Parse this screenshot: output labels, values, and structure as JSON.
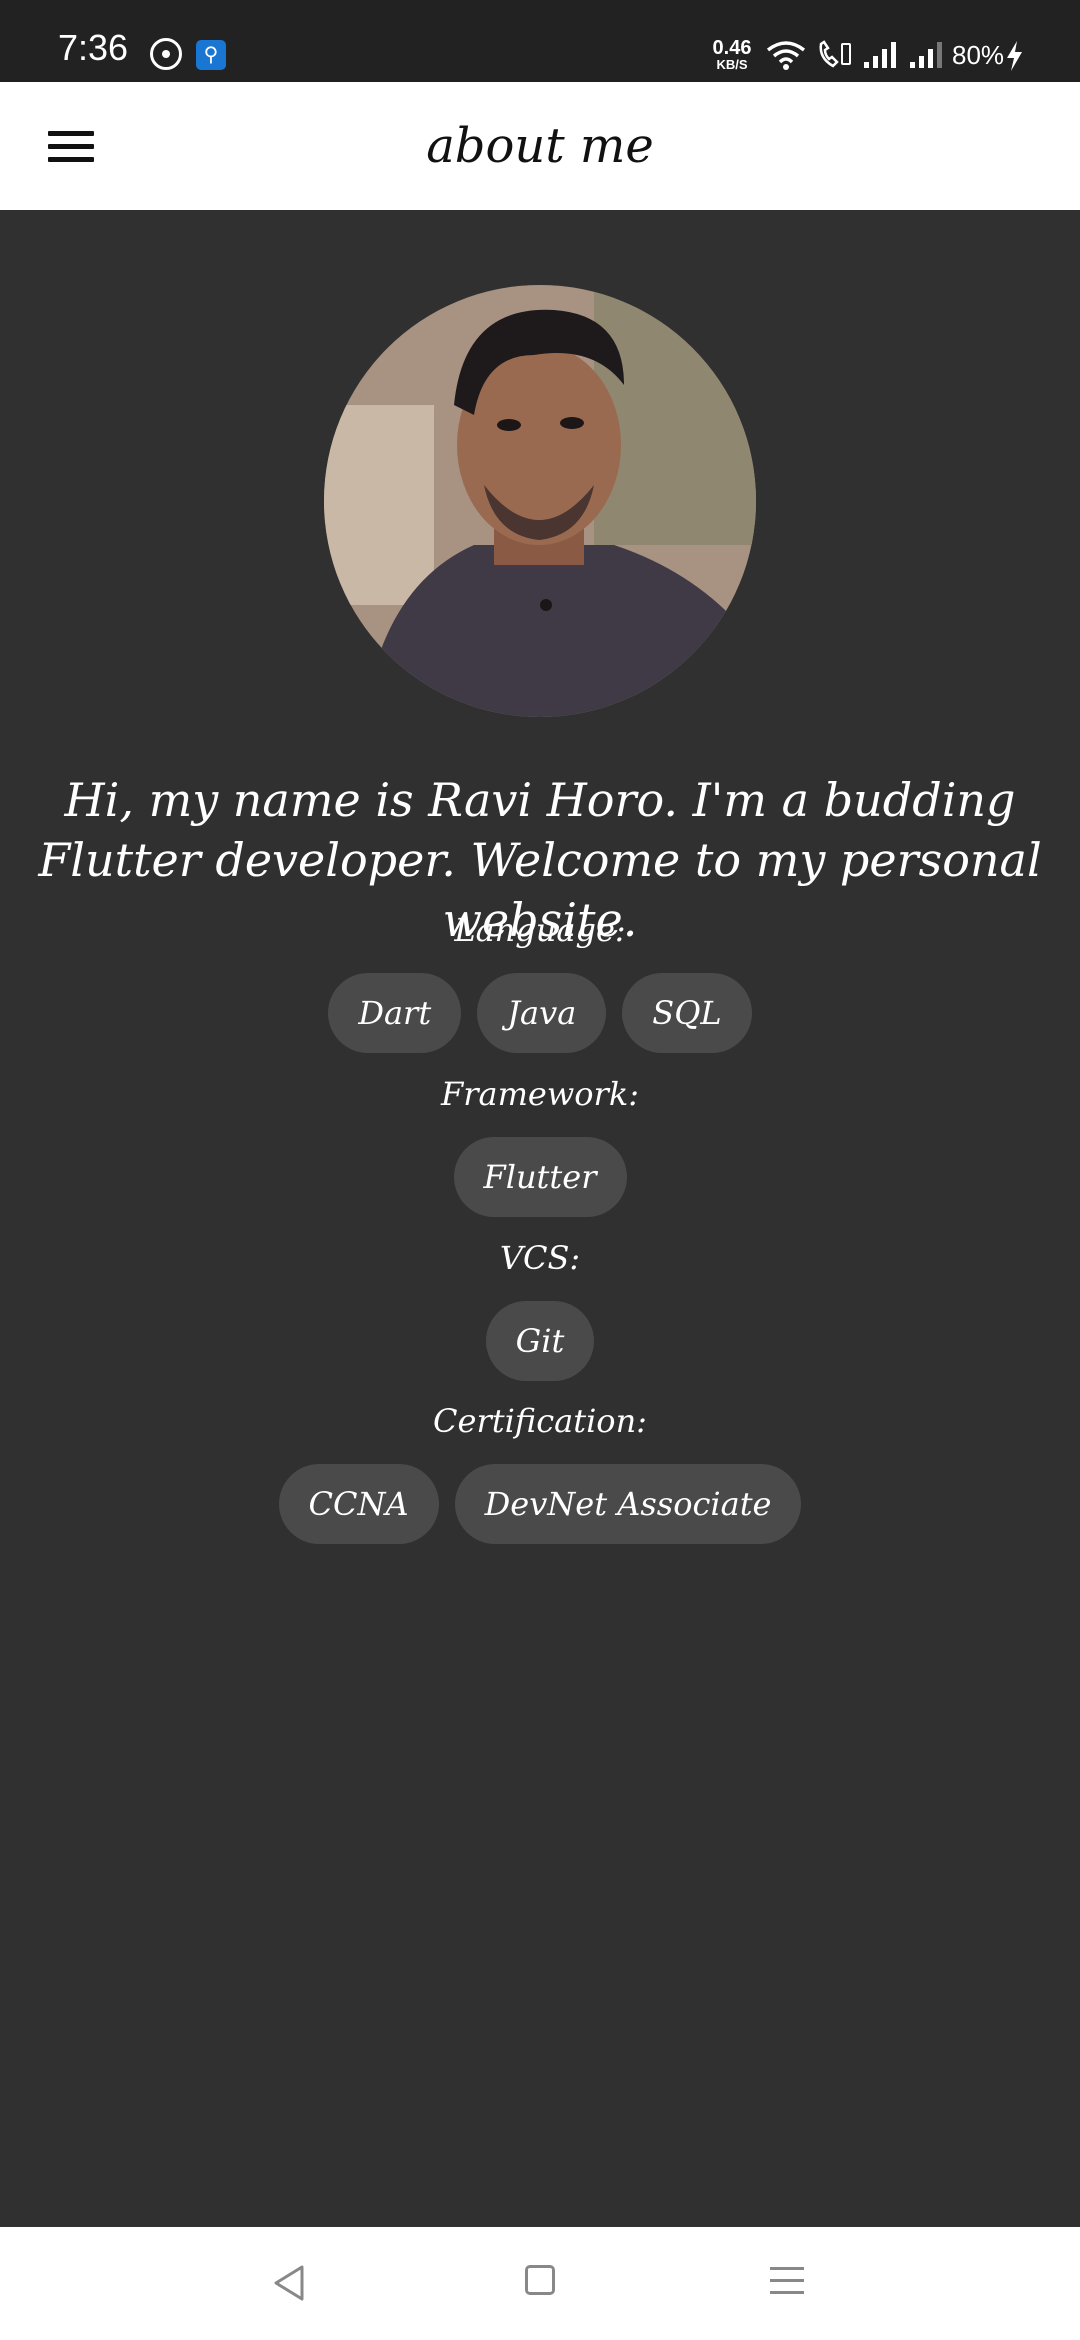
{
  "status_bar": {
    "time": "7:36",
    "speed_value": "0.46",
    "speed_unit": "KB/S",
    "battery": "80%",
    "icons": [
      "music-icon",
      "usb-icon",
      "wifi-icon",
      "wifi-calling-icon",
      "signal-icon",
      "signal-icon",
      "charging-icon"
    ]
  },
  "app_bar": {
    "title": "about me",
    "menu_icon": "hamburger-menu-icon"
  },
  "profile": {
    "intro": "Hi, my name is Ravi Horo. I'm a budding Flutter developer. Welcome to my personal website."
  },
  "skills": {
    "language": {
      "label": "Language:",
      "chips": [
        "Dart",
        "Java",
        "SQL"
      ]
    },
    "framework": {
      "label": "Framework:",
      "chips": [
        "Flutter"
      ]
    },
    "vcs": {
      "label": "VCS:",
      "chips": [
        "Git"
      ]
    },
    "certification": {
      "label": "Certification:",
      "chips": [
        "CCNA",
        "DevNet Associate"
      ]
    }
  },
  "colors": {
    "background": "#303030",
    "app_bar": "#ffffff",
    "chip": "#4a4a4a",
    "text_light": "#ffffff"
  }
}
